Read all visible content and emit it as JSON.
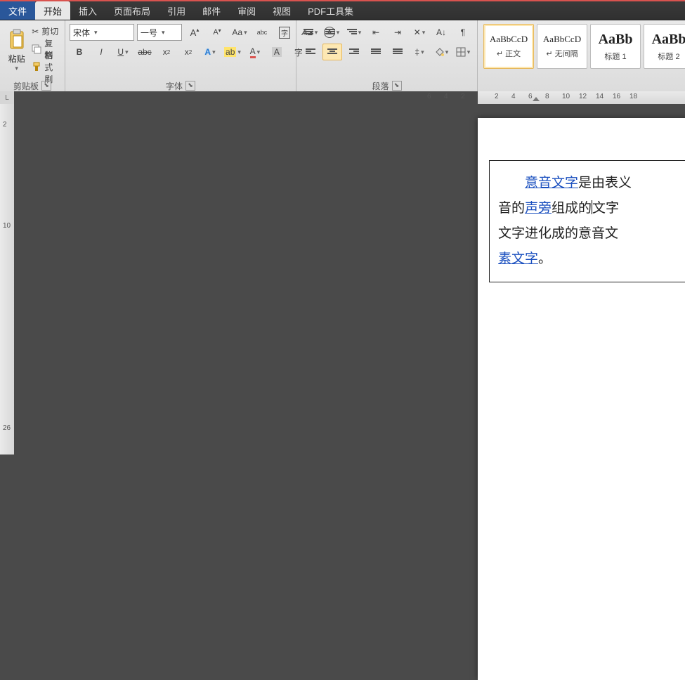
{
  "menu": {
    "file": "文件",
    "home": "开始",
    "insert": "插入",
    "layout": "页面布局",
    "ref": "引用",
    "mail": "邮件",
    "review": "审阅",
    "view": "视图",
    "pdf": "PDF工具集"
  },
  "clipboard": {
    "paste": "粘贴",
    "cut": "剪切",
    "copy": "复制",
    "painter": "格式刷",
    "label": "剪贴板"
  },
  "font": {
    "name": "宋体",
    "size": "一号",
    "label": "字体"
  },
  "para": {
    "label": "段落"
  },
  "styles": {
    "items": [
      {
        "preview": "AaBbCcD",
        "name": "↵ 正文",
        "big": false,
        "sel": true
      },
      {
        "preview": "AaBbCcD",
        "name": "↵ 无间隔",
        "big": false,
        "sel": false
      },
      {
        "preview": "AaBb",
        "name": "标题 1",
        "big": true,
        "sel": false
      },
      {
        "preview": "AaBb",
        "name": "标题 2",
        "big": true,
        "sel": false
      }
    ]
  },
  "ruler": {
    "h": [
      "6",
      "4",
      "2",
      "",
      "2",
      "4",
      "6",
      "8",
      "10",
      "12",
      "14",
      "16",
      "18"
    ],
    "v": [
      "",
      "2",
      "",
      "",
      "",
      "",
      "",
      "10",
      "",
      "",
      "",
      "",
      "",
      "",
      "",
      "",
      "",
      "",
      "",
      "26",
      ""
    ]
  },
  "cornerL": "L",
  "doc": {
    "link1": "意音文字",
    "t1": "是由表义",
    "t2": "音的",
    "link2": "声旁",
    "t3": "组成的",
    "t4": "文字",
    "t5": "文字进化成的意音文",
    "link3": "素文字",
    "t6": "。"
  }
}
